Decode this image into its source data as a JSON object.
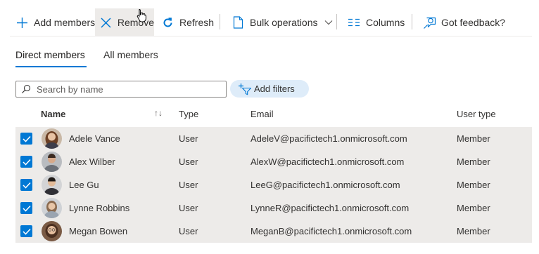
{
  "toolbar": {
    "add_members": "Add members",
    "remove": "Remove",
    "refresh": "Refresh",
    "bulk_operations": "Bulk operations",
    "columns": "Columns",
    "feedback": "Got feedback?"
  },
  "tabs": [
    {
      "label": "Direct members",
      "active": true
    },
    {
      "label": "All members",
      "active": false
    }
  ],
  "search": {
    "placeholder": "Search by name",
    "value": ""
  },
  "filters": {
    "label": "Add filters"
  },
  "table": {
    "headers": {
      "name": "Name",
      "type": "Type",
      "email": "Email",
      "user_type": "User type"
    },
    "rows": [
      {
        "name": "Adele Vance",
        "type": "User",
        "email": "AdeleV@pacifictech1.onmicrosoft.com",
        "user_type": "Member",
        "selected": true
      },
      {
        "name": "Alex Wilber",
        "type": "User",
        "email": "AlexW@pacifictech1.onmicrosoft.com",
        "user_type": "Member",
        "selected": true
      },
      {
        "name": "Lee Gu",
        "type": "User",
        "email": "LeeG@pacifictech1.onmicrosoft.com",
        "user_type": "Member",
        "selected": true
      },
      {
        "name": "Lynne Robbins",
        "type": "User",
        "email": "LynneR@pacifictech1.onmicrosoft.com",
        "user_type": "Member",
        "selected": true
      },
      {
        "name": "Megan Bowen",
        "type": "User",
        "email": "MeganB@pacifictech1.onmicrosoft.com",
        "user_type": "Member",
        "selected": true
      }
    ]
  },
  "colors": {
    "accent": "#0078d4",
    "row_selected": "#edebe9",
    "filter_pill": "#deecf9"
  },
  "icons": {
    "add": "plus-icon",
    "remove": "x-icon",
    "refresh": "refresh-icon",
    "bulk": "document-icon",
    "columns": "columns-icon",
    "feedback": "feedback-icon",
    "search": "search-icon",
    "filter": "filter-icon",
    "sort": "sort-icon",
    "check": "checkmark-icon"
  }
}
